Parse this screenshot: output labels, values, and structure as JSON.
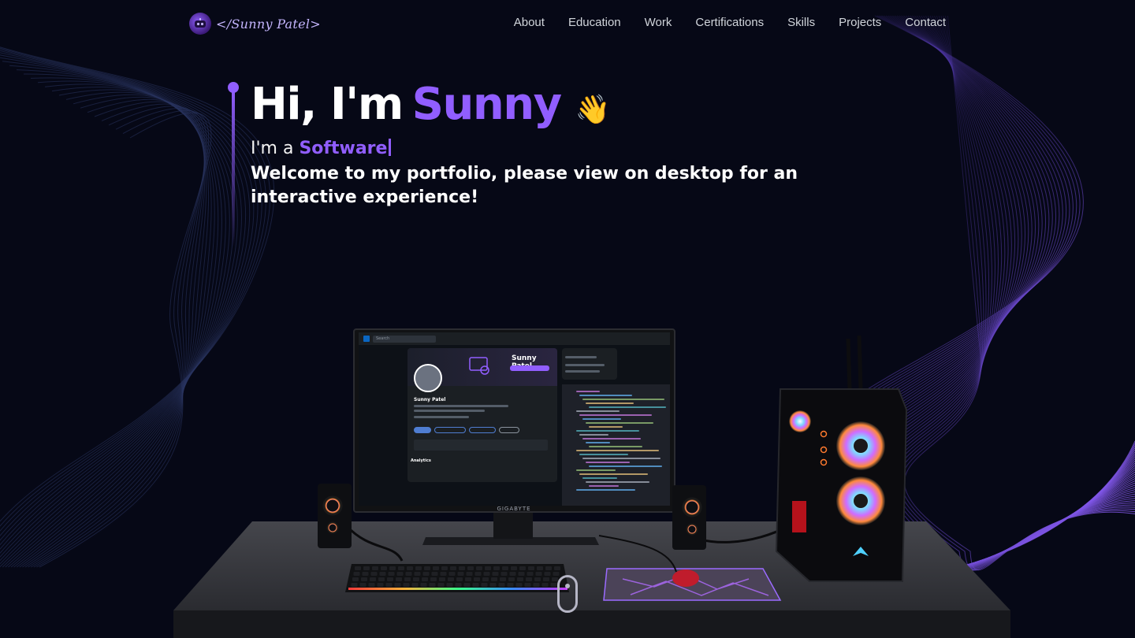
{
  "nav": {
    "logo_text": "</Sunny Patel>",
    "links": [
      "About",
      "Education",
      "Work",
      "Certifications",
      "Skills",
      "Projects",
      "Contact"
    ]
  },
  "hero": {
    "greeting": "Hi, I'm",
    "name": "Sunny",
    "emoji": "👋",
    "typed_prefix": "I'm a",
    "typed_role": "Software",
    "welcome": "Welcome to my portfolio, please view on desktop for an interactive experience!"
  },
  "scene": {
    "monitor_brand": "GIGABYTE",
    "screen_profile_name": "Sunny Patel",
    "screen_analytics": "Analytics",
    "screen_search": "Search"
  },
  "colors": {
    "accent": "#915eff",
    "background": "#060816",
    "text": "#ffffff"
  },
  "icons": {
    "logo": "robot-avatar-icon",
    "wave": "waving-hand-icon",
    "scroll": "mouse-scroll-icon"
  }
}
